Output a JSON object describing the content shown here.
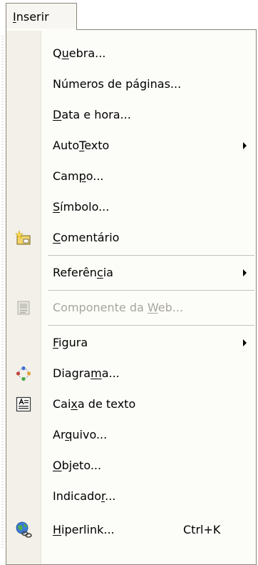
{
  "menubar": {
    "tab_label": "Inserir"
  },
  "menu": {
    "items": [
      {
        "label": "Quebra...",
        "mnemonic_index": 1
      },
      {
        "label": "Números de páginas...",
        "mnemonic_index": -1
      },
      {
        "label": "Data e hora...",
        "mnemonic_index": 0
      },
      {
        "label": "AutoTexto",
        "mnemonic_index": 4,
        "submenu": true
      },
      {
        "label": "Campo...",
        "mnemonic_index": 3
      },
      {
        "label": "Símbolo...",
        "mnemonic_index": 0
      },
      {
        "label": "Comentário",
        "mnemonic_index": 0,
        "icon": "comment-icon"
      },
      {
        "label": "Referência",
        "mnemonic_index": 7,
        "submenu": true
      },
      {
        "label": "Componente da Web...",
        "mnemonic_index": 14,
        "disabled": true,
        "icon": "web-component-icon"
      },
      {
        "label": "Figura",
        "mnemonic_index": 0,
        "submenu": true
      },
      {
        "label": "Diagrama...",
        "mnemonic_index": 6,
        "icon": "diagram-icon"
      },
      {
        "label": "Caixa de texto",
        "mnemonic_index": 3,
        "icon": "text-box-icon"
      },
      {
        "label": "Arquivo...",
        "mnemonic_index": 2
      },
      {
        "label": "Objeto...",
        "mnemonic_index": 0
      },
      {
        "label": "Indicador...",
        "mnemonic_index": 8
      },
      {
        "label": "Hiperlink...",
        "mnemonic_index": 0,
        "shortcut": "Ctrl+K",
        "icon": "hyperlink-icon"
      }
    ]
  },
  "colors": {
    "disabled_text": "#a7a69d",
    "gutter": "#f2f0e8",
    "border": "#8a867a"
  }
}
